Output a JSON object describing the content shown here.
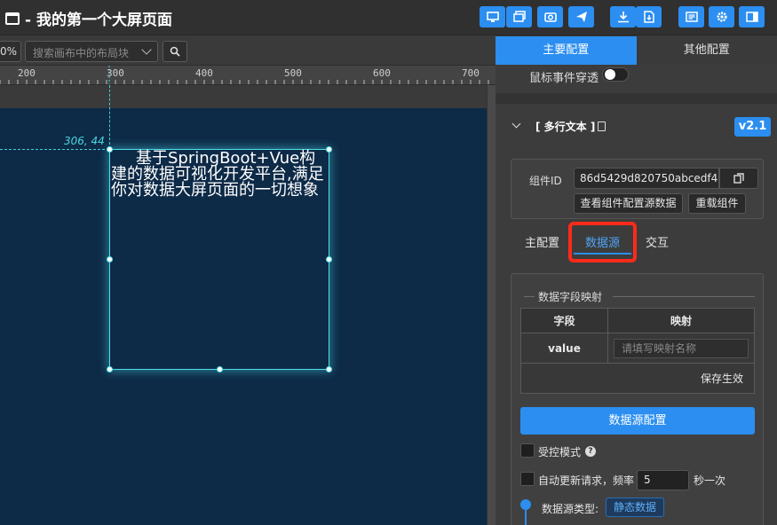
{
  "header": {
    "title": "- 我的第一个大屏页面"
  },
  "toolbar": {
    "zoom": "0%",
    "search_placeholder": "搜索画布中的布局块"
  },
  "ruler": {
    "labels": [
      "200",
      "300",
      "400",
      "500",
      "600",
      "700"
    ]
  },
  "canvas": {
    "coordinate_readout": "306, 44",
    "widget_text": "基于SpringBoot+Vue构建的数据可视化开发平台,满足你对数据大屏页面的一切想象"
  },
  "panel": {
    "tabs": [
      "主要配置",
      "其他配置"
    ],
    "mouse_passthrough_label": "鼠标事件穿透",
    "section_title": "[ 多行文本 ]",
    "version": "v2.1",
    "component_id_label": "组件ID",
    "component_id_value": "86d5429d820750abcedf4",
    "view_config_button": "查看组件配置源数据",
    "reload_button": "重载组件",
    "subtabs": [
      "主配置",
      "数据源",
      "交互"
    ],
    "mapping_legend": "数据字段映射",
    "table_headers": [
      "字段",
      "映射"
    ],
    "table_rows": [
      {
        "field": "value",
        "mapping_placeholder": "请填写映射名称"
      }
    ],
    "save_label": "保存生效",
    "datasource_config_button": "数据源配置",
    "controlled_mode_label": "受控模式",
    "auto_update_label": "自动更新请求，频率",
    "frequency_value": "5",
    "frequency_unit": "秒一次",
    "datasource_type_label": "数据源类型:",
    "datasource_type_value": "静态数据"
  },
  "colors": {
    "accent": "#2b8ef0",
    "canvas_bg": "#0d2a47",
    "selection": "#4fe0e8",
    "highlight": "#ff2a1a"
  }
}
